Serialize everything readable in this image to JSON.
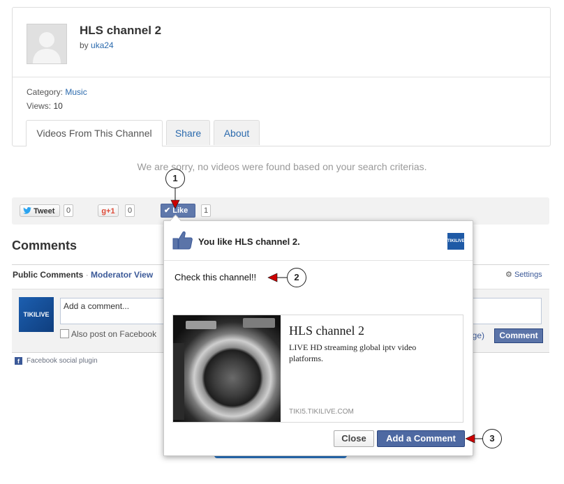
{
  "channel": {
    "title": "HLS channel 2",
    "by_prefix": "by",
    "author": "uka24",
    "category_label": "Category:",
    "category_value": "Music",
    "views_label": "Views:",
    "views_value": "10"
  },
  "tabs": [
    {
      "label": "Videos From This Channel",
      "active": true
    },
    {
      "label": "Share",
      "active": false
    },
    {
      "label": "About",
      "active": false
    }
  ],
  "empty_message": "We are sorry, no videos were found based on your search criterias.",
  "share": {
    "tweet_label": "Tweet",
    "tweet_count": "0",
    "gplus_label": "+1",
    "gplus_count": "0",
    "like_label": "Like",
    "like_count": "1"
  },
  "comments": {
    "heading": "Comments",
    "public_tab": "Public Comments",
    "separator": "·",
    "moderator_tab": "Moderator View",
    "settings_label": "Settings",
    "input_placeholder": "Add a comment...",
    "also_post": "Also post on Facebook",
    "change_fragment": "nge)",
    "comment_button": "Comment",
    "plugin_label": "Facebook social plugin",
    "thumb_brand": "TIKILIVE"
  },
  "popup": {
    "title": "You like HLS channel 2.",
    "message": "Check this channel!!",
    "logo_text": "TIKILIVE",
    "preview_title": "HLS channel 2",
    "preview_desc": "LIVE HD streaming global iptv video platforms.",
    "preview_domain": "TIKI5.TIKILIVE.COM",
    "close_label": "Close",
    "add_label": "Add a Comment"
  },
  "callouts": [
    "1",
    "2",
    "3"
  ],
  "colors": {
    "link": "#2b6aad",
    "facebook_blue": "#3b5998",
    "callout_arrow": "#cc0000"
  }
}
